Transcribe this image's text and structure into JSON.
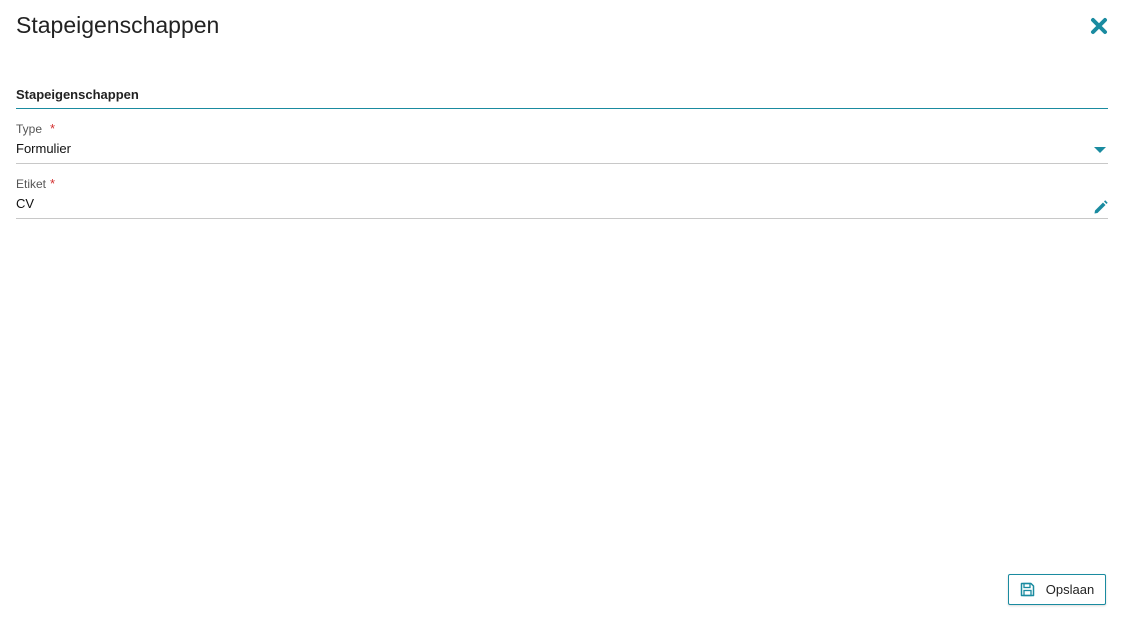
{
  "dialog": {
    "title": "Stapeigenschappen",
    "close_icon": "close-icon",
    "accent_color": "#1a8ba0"
  },
  "section": {
    "title": "Stapeigenschappen"
  },
  "fields": {
    "type": {
      "label": "Type",
      "required_marker": "*",
      "value": "Formulier",
      "icon": "caret-down-icon"
    },
    "etiket": {
      "label": "Etiket",
      "required_marker": "*",
      "value": "CV",
      "icon": "pencil-icon"
    }
  },
  "footer": {
    "save_label": "Opslaan",
    "save_icon": "floppy-disk-icon"
  }
}
